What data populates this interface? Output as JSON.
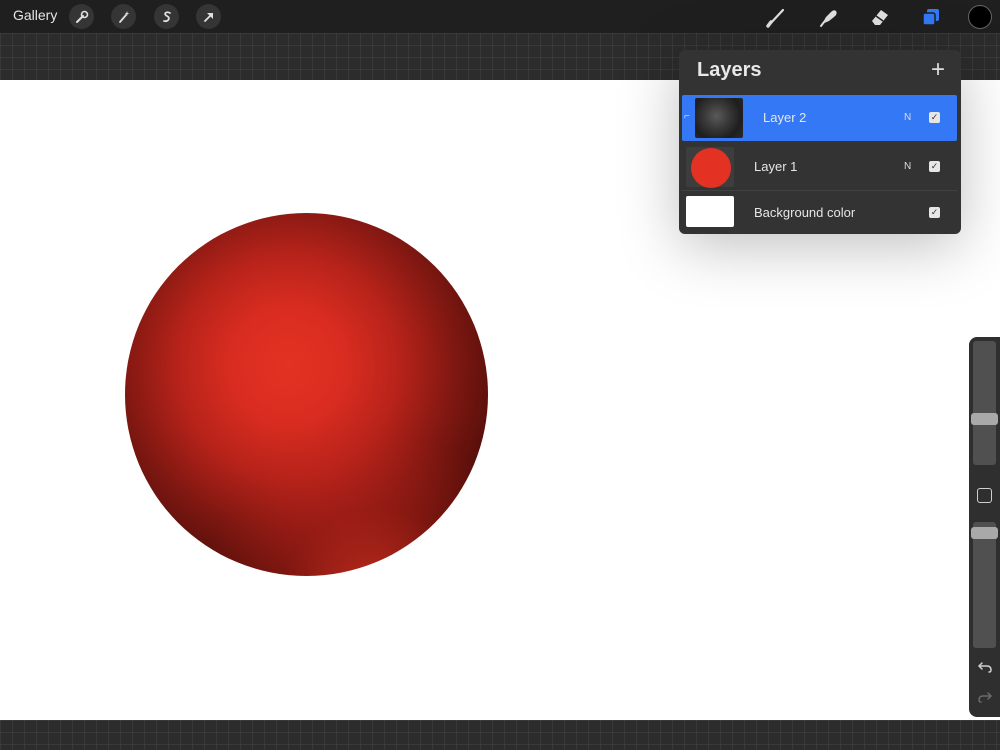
{
  "topbar": {
    "gallery_label": "Gallery",
    "left_tools": [
      "wrench-icon",
      "magic-wand-icon",
      "selection-icon",
      "transform-arrow-icon"
    ],
    "right_tools": [
      "brush-icon",
      "smudge-icon",
      "eraser-icon",
      "layers-icon"
    ],
    "active_color": "#000000",
    "accent": "#3478f6"
  },
  "canvas": {
    "background": "#ffffff",
    "sphere_base_color": "#e33224"
  },
  "layers_panel": {
    "title": "Layers",
    "add_symbol": "+",
    "layers": [
      {
        "name": "Layer 2",
        "blend": "N",
        "visible": true,
        "selected": true,
        "clipping": true
      },
      {
        "name": "Layer 1",
        "blend": "N",
        "visible": true,
        "selected": false
      },
      {
        "name": "Background color",
        "blend": "",
        "visible": true,
        "selected": false
      }
    ]
  },
  "sidebar": {
    "brush_size_level": 0.24,
    "opacity_level": 0.1,
    "undo_icon": "undo-icon",
    "redo_icon": "redo-icon"
  }
}
